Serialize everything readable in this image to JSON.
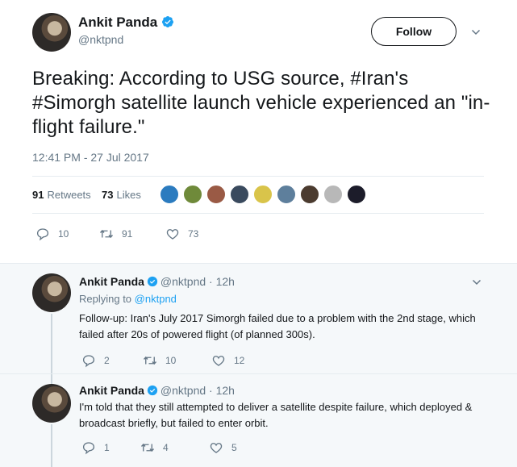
{
  "main_tweet": {
    "author_name": "Ankit Panda",
    "handle": "@nktpnd",
    "follow_label": "Follow",
    "text": "Breaking: According to USG source, #Iran's #Simorgh satellite launch vehicle experienced an \"in-flight failure.\"",
    "timestamp": "12:41 PM - 27 Jul 2017",
    "retweets_count": "91",
    "retweets_label": "Retweets",
    "likes_count": "73",
    "likes_label": "Likes",
    "actions": {
      "replies": "10",
      "retweets": "91",
      "likes": "73"
    }
  },
  "replies": [
    {
      "author_name": "Ankit Panda",
      "handle_time": "@nktpnd · 12h",
      "replying_prefix": "Replying to",
      "replying_to": "@nktpnd",
      "text": "Follow-up: Iran's July 2017 Simorgh failed due to a problem with the 2nd stage, which failed after 20s of powered flight (of planned 300s).",
      "actions": {
        "replies": "2",
        "retweets": "10",
        "likes": "12"
      }
    },
    {
      "author_name": "Ankit Panda",
      "handle_time": "@nktpnd · 12h",
      "text": "I'm told that they still attempted to deliver a satellite despite failure, which deployed & broadcast briefly, but failed to enter orbit.",
      "actions": {
        "replies": "1",
        "retweets": "4",
        "likes": "5"
      }
    }
  ],
  "colors": {
    "verified": "#1da1f2",
    "text_primary": "#14171a",
    "text_secondary": "#657786",
    "link": "#1da1f2",
    "reply_background": "#f5f8fa"
  },
  "icons": [
    "verified-badge-icon",
    "chevron-down-icon",
    "reply-icon",
    "retweet-icon",
    "like-icon"
  ]
}
